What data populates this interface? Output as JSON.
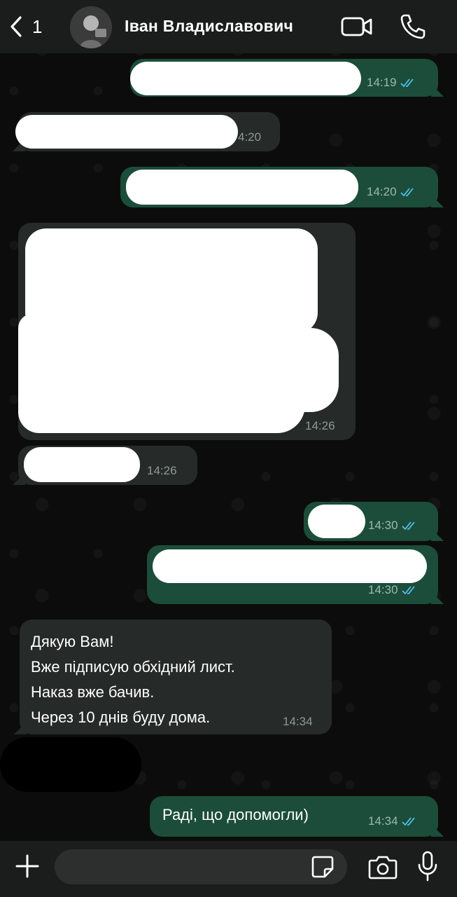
{
  "header": {
    "back_count": "1",
    "contact_name": "Іван Владиславович",
    "icons": {
      "back": "chevron-left-icon",
      "video": "video-call-icon",
      "call": "phone-icon",
      "avatar": "contact-avatar"
    }
  },
  "messages": [
    {
      "direction": "outgoing",
      "time": "14:19",
      "status": "read",
      "content": "redacted"
    },
    {
      "direction": "incoming",
      "time": "4:20",
      "content": "redacted"
    },
    {
      "direction": "outgoing",
      "time": "14:20",
      "status": "read",
      "content": "redacted"
    },
    {
      "direction": "incoming",
      "time": "14:26",
      "content": "redacted"
    },
    {
      "direction": "incoming",
      "time": "14:26",
      "content": "redacted"
    },
    {
      "direction": "outgoing",
      "time": "14:30",
      "status": "read",
      "content": "redacted"
    },
    {
      "direction": "outgoing",
      "time": "14:30",
      "status": "read",
      "content": "redacted"
    },
    {
      "direction": "incoming",
      "time": "14:34",
      "lines": [
        "Дякую Вам!",
        "Вже підписую обхідний лист.",
        "Наказ вже бачив.",
        "Через 10 днів буду дома."
      ]
    },
    {
      "direction": "outgoing",
      "time": "14:34",
      "status": "read",
      "text": "Раді, що допомогли)"
    }
  ],
  "input_bar": {
    "placeholder": "",
    "icons": {
      "attach": "plus-icon",
      "sticker": "sticker-icon",
      "camera": "camera-icon",
      "mic": "microphone-icon"
    }
  },
  "colors": {
    "outgoing_bubble": "#1b4d3a",
    "incoming_bubble": "#262a29",
    "read_ticks": "#53bdeb",
    "header_bg": "#1b1d1c"
  }
}
